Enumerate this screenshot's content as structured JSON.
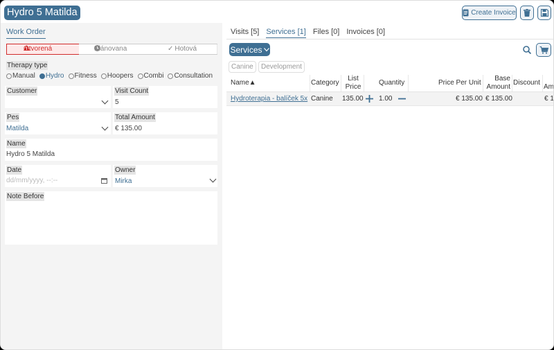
{
  "header": {
    "title": "Hydro 5 Matilda",
    "create_invoice_label": "Create Invoice"
  },
  "left": {
    "work_order_tab": "Work Order",
    "status_steps": [
      "Otvorená",
      "Plánovana",
      "Hotová"
    ],
    "therapy_type_label": "Therapy type",
    "therapy_options": [
      "Manual",
      "Hydro",
      "Fitness",
      "Hoopers",
      "Combi",
      "Consultation"
    ],
    "therapy_selected": "Hydro",
    "customer_label": "Customer",
    "customer_value": "",
    "visit_count_label": "Visit Count",
    "visit_count_value": "5",
    "pes_label": "Pes",
    "pes_value": "Matilda",
    "total_amount_label": "Total Amount",
    "total_amount_value": "€ 135.00",
    "name_label": "Name",
    "name_value": "Hydro 5 Matilda",
    "date_label": "Date",
    "date_placeholder": "dd/mm/yyyy, --:--",
    "owner_label": "Owner",
    "owner_value": "Mirka",
    "note_before_label": "Note Before"
  },
  "right": {
    "tabs": [
      "Visits [5]",
      "Services [1]",
      "Files [0]",
      "Invoices [0]"
    ],
    "active_tab": "Services [1]",
    "services_button": "Services",
    "chips": [
      "Canine",
      "Development"
    ],
    "columns": {
      "name": "Name▲",
      "category": "Category",
      "list_price_1": "List",
      "list_price_2": "Price",
      "quantity": "Quantity",
      "price_per_unit": "Price Per Unit",
      "base_amount_1": "Base",
      "base_amount_2": "Amount",
      "discount": "Discount",
      "amount": "Am"
    },
    "rows": [
      {
        "name": "Hydroterapia - balíček 5x",
        "category": "Canine",
        "list_price": "135.00",
        "quantity": "1.00",
        "price_per_unit": "€ 135.00",
        "base_amount": "€ 135.00",
        "amount": "€ 1"
      }
    ]
  },
  "colors": {
    "accent": "#3f6f93",
    "status_active": "#d12c2c"
  }
}
